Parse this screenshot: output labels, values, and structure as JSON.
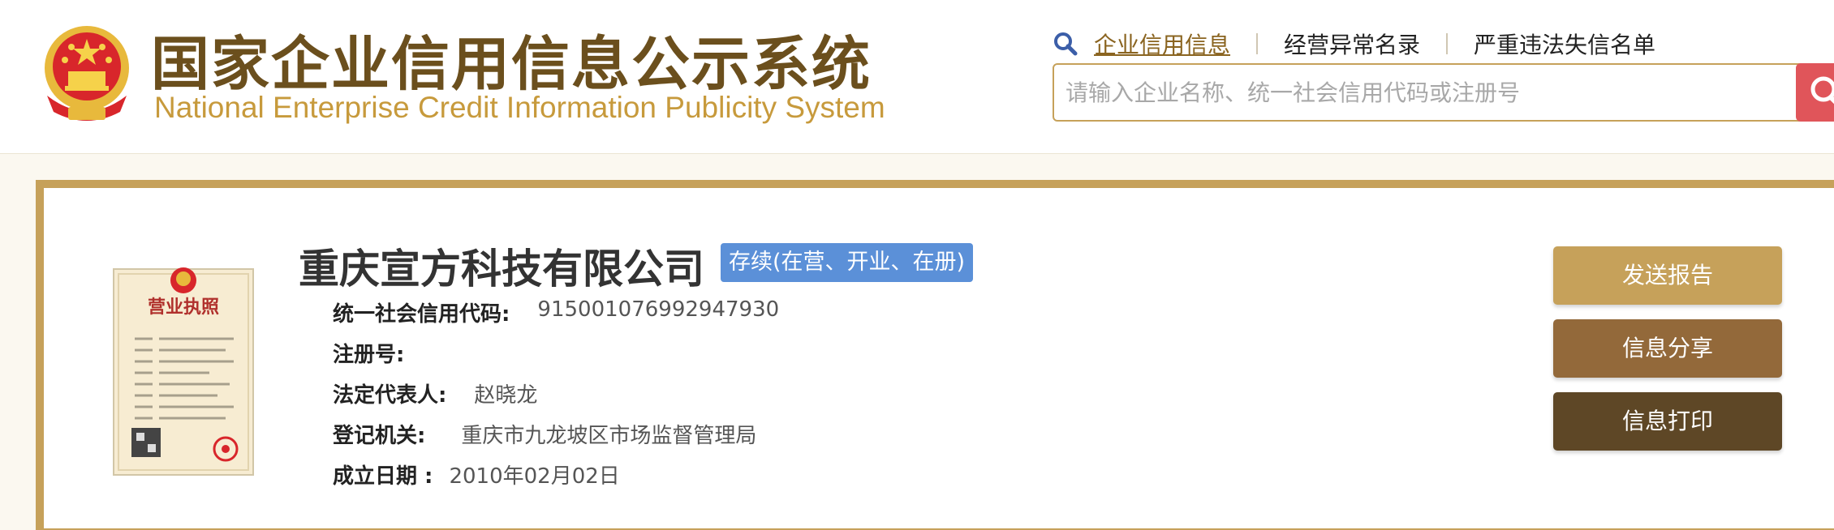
{
  "header": {
    "title_cn": "国家企业信用信息公示系统",
    "title_en": "National Enterprise Credit Information Publicity System",
    "nav": [
      {
        "label": "企业信用信息"
      },
      {
        "label": "经营异常名录"
      },
      {
        "label": "严重违法失信名单"
      }
    ],
    "search_placeholder": "请输入企业名称、统一社会信用代码或注册号"
  },
  "company": {
    "name": "重庆宣方科技有限公司",
    "status": "存续(在营、开业、在册)",
    "fields": [
      {
        "label": "统一社会信用代码:",
        "value": "915001076992947930"
      },
      {
        "label": "注册号:",
        "value": ""
      },
      {
        "label": "法定代表人:",
        "value": "赵晓龙"
      },
      {
        "label": "登记机关:",
        "value": "重庆市九龙坡区市场监督管理局"
      },
      {
        "label": "成立日期 :",
        "value": "2010年02月02日"
      }
    ]
  },
  "license_image": {
    "title": "营业执照"
  },
  "actions": {
    "send_report": "发送报告",
    "share": "信息分享",
    "print": "信息打印"
  },
  "colors": {
    "gold": "#c6a15a",
    "brown": "#93693a",
    "dark_brown": "#5e4726",
    "status_blue": "#5b90d8",
    "search_red": "#e0555a"
  },
  "icons": [
    "national-emblem-icon",
    "search-icon",
    "magnifier-icon",
    "business-license-image"
  ]
}
